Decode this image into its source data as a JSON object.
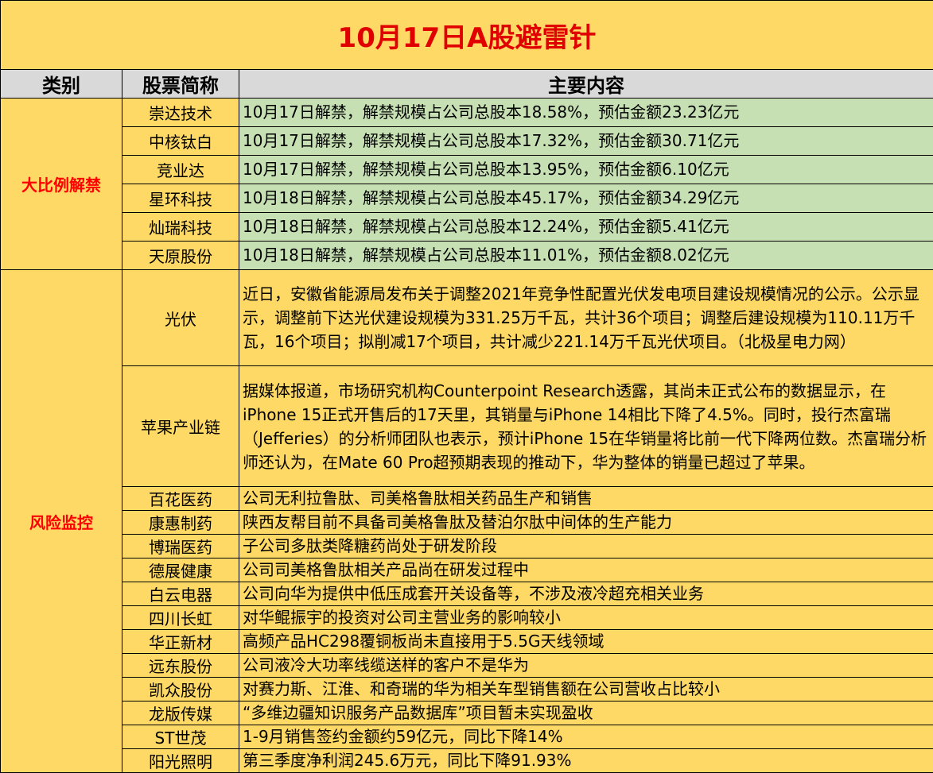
{
  "title": "10月17日A股避雷针",
  "headers": {
    "category": "类别",
    "stock": "股票简称",
    "content": "主要内容"
  },
  "categories": {
    "unlock": "大比例解禁",
    "risk": "风险监控"
  },
  "unlock_rows": [
    {
      "name": "崇达技术",
      "text": "10月17日解禁，解禁规模占公司总股本18.58%，预估金额23.23亿元"
    },
    {
      "name": "中核钛白",
      "text": "10月17日解禁，解禁规模占公司总股本17.32%，预估金额30.71亿元"
    },
    {
      "name": "竞业达",
      "text": "10月17日解禁，解禁规模占公司总股本13.95%，预估金额6.10亿元"
    },
    {
      "name": "星环科技",
      "text": "10月18日解禁，解禁规模占公司总股本45.17%，预估金额34.29亿元"
    },
    {
      "name": "灿瑞科技",
      "text": "10月18日解禁，解禁规模占公司总股本12.24%，预估金额5.41亿元"
    },
    {
      "name": "天原股份",
      "text": "10月18日解禁，解禁规模占公司总股本11.01%，预估金额8.02亿元"
    }
  ],
  "risk_rows": [
    {
      "name": "光伏",
      "text": "近日，安徽省能源局发布关于调整2021年竞争性配置光伏发电项目建设规模情况的公示。公示显示，调整前下达光伏建设规模为331.25万千瓦，共计36个项目；调整后建设规模为110.11万千瓦，16个项目；拟削减17个项目，共计减少221.14万千瓦光伏项目。（北极星电力网）"
    },
    {
      "name": "苹果产业链",
      "text": "据媒体报道，市场研究机构Counterpoint Research透露，其尚未正式公布的数据显示，在iPhone 15正式开售后的17天里，其销量与iPhone 14相比下降了4.5%。同时，投行杰富瑞（Jefferies）的分析师团队也表示，预计iPhone 15在华销量将比前一代下降两位数。杰富瑞分析师还认为，在Mate 60 Pro超预期表现的推动下，华为整体的销量已超过了苹果。"
    },
    {
      "name": "百花医药",
      "text": "公司无利拉鲁肽、司美格鲁肽相关药品生产和销售"
    },
    {
      "name": "康惠制药",
      "text": "陕西友帮目前不具备司美格鲁肽及替泊尔肽中间体的生产能力"
    },
    {
      "name": "博瑞医药",
      "text": "子公司多肽类降糖药尚处于研发阶段"
    },
    {
      "name": "德展健康",
      "text": "公司司美格鲁肽相关产品尚在研发过程中"
    },
    {
      "name": "白云电器",
      "text": "公司向华为提供中低压成套开关设备等，不涉及液冷超充相关业务"
    },
    {
      "name": "四川长虹",
      "text": "对华鲲振宇的投资对公司主营业务的影响较小"
    },
    {
      "name": "华正新材",
      "text": "高频产品HC298覆铜板尚未直接用于5.5G天线领域"
    },
    {
      "name": "远东股份",
      "text": "公司液冷大功率线缆送样的客户不是华为"
    },
    {
      "name": "凯众股份",
      "text": "对赛力斯、江淮、和奇瑞的华为相关车型销售额在公司营收占比较小"
    },
    {
      "name": "龙版传媒",
      "text": "“多维边疆知识服务产品数据库”项目暂未实现盈收"
    },
    {
      "name": "ST世茂",
      "text": "1-9月销售签约金额约59亿元，同比下降14%"
    },
    {
      "name": "阳光照明",
      "text": "第三季度净利润245.6万元，同比下降91.93%"
    }
  ],
  "colors": {
    "title_red": "#e00000",
    "header_gray": "#d9d9d9",
    "unlock_green": "#c6e0b4",
    "risk_yellow": "#ffd966"
  }
}
